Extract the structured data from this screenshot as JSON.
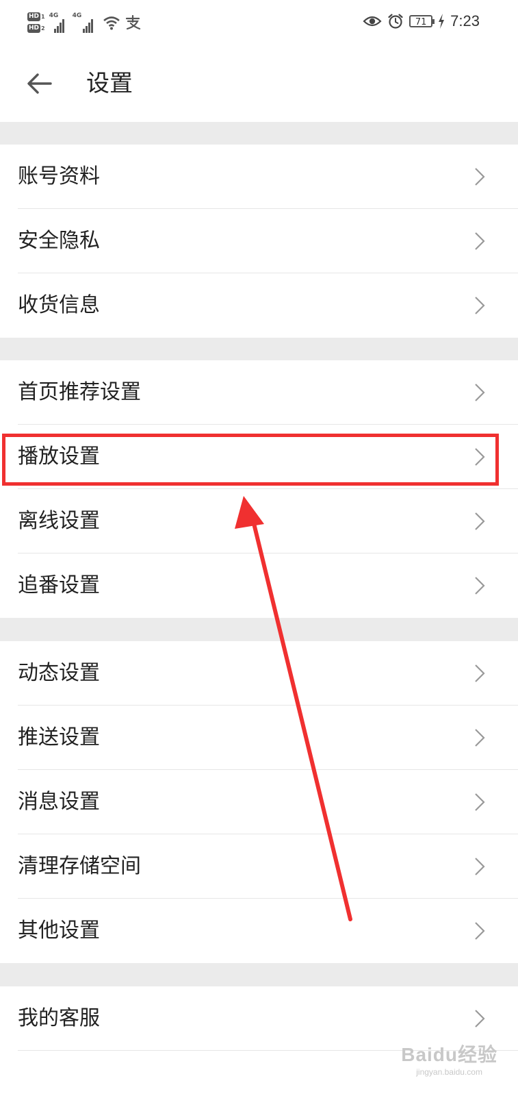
{
  "status_bar": {
    "hd1": "HD",
    "hd1_sub": "1",
    "hd2": "HD",
    "hd2_sub": "2",
    "signal1_label": "4G",
    "signal2_label": "4G",
    "battery": "71",
    "time": "7:23",
    "icons": [
      "wifi-icon",
      "alipay-icon",
      "eye-icon",
      "alarm-icon",
      "battery-icon",
      "charging-icon"
    ]
  },
  "header": {
    "title": "设置",
    "back_icon": "back-arrow-icon"
  },
  "groups": [
    {
      "items": [
        {
          "label": "账号资料"
        },
        {
          "label": "安全隐私"
        },
        {
          "label": "收货信息"
        }
      ]
    },
    {
      "items": [
        {
          "label": "首页推荐设置"
        },
        {
          "label": "播放设置"
        },
        {
          "label": "离线设置"
        },
        {
          "label": "追番设置"
        }
      ]
    },
    {
      "items": [
        {
          "label": "动态设置"
        },
        {
          "label": "推送设置"
        },
        {
          "label": "消息设置"
        },
        {
          "label": "清理存储空间"
        },
        {
          "label": "其他设置"
        }
      ]
    },
    {
      "items": [
        {
          "label": "我的客服"
        }
      ]
    }
  ],
  "annotation": {
    "highlighted_item": "播放设置",
    "color": "#f03030"
  },
  "watermark": {
    "main": "Baidu经验",
    "sub": "jingyan.baidu.com"
  }
}
